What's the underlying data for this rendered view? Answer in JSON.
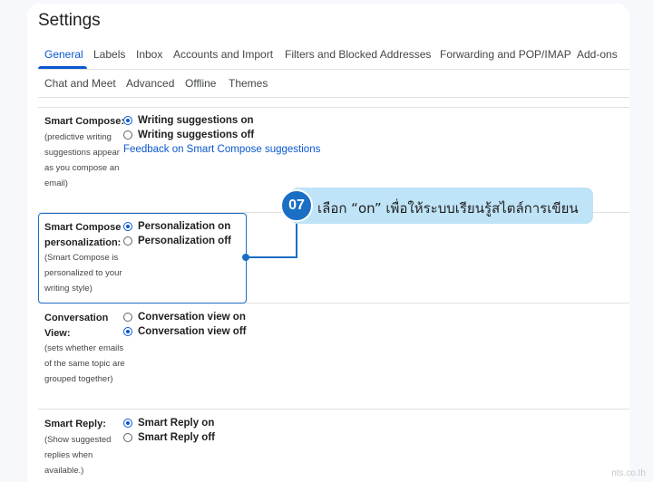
{
  "page": {
    "title": "Settings"
  },
  "tabs": [
    {
      "label": "General",
      "active": true
    },
    {
      "label": "Labels"
    },
    {
      "label": "Inbox"
    },
    {
      "label": "Accounts and Import"
    },
    {
      "label": "Filters and Blocked Addresses"
    },
    {
      "label": "Forwarding and POP/IMAP"
    },
    {
      "label": "Add-ons"
    },
    {
      "label": "Chat and Meet"
    },
    {
      "label": "Advanced"
    },
    {
      "label": "Offline"
    },
    {
      "label": "Themes"
    }
  ],
  "settings": {
    "smart_compose": {
      "title": "Smart Compose:",
      "desc": "(predictive writing suggestions appear as you compose an email)",
      "options": [
        "Writing suggestions on",
        "Writing suggestions off"
      ],
      "selected": 0,
      "link": "Feedback on Smart Compose suggestions"
    },
    "personalization": {
      "title": "Smart Compose personalization:",
      "desc": "(Smart Compose is personalized to your writing style)",
      "options": [
        "Personalization on",
        "Personalization off"
      ],
      "selected": 0
    },
    "conversation_view": {
      "title": "Conversation View:",
      "desc": "(sets whether emails of the same topic are grouped together)",
      "options": [
        "Conversation view on",
        "Conversation view off"
      ],
      "selected": 1
    },
    "smart_reply": {
      "title": "Smart Reply:",
      "desc": "(Show suggested replies when available.)",
      "options": [
        "Smart Reply on",
        "Smart Reply off"
      ],
      "selected": 0
    }
  },
  "callout": {
    "number": "07",
    "text": "เลือก “on” เพื่อให้ระบบเรียนรู้สไตล์การเขียน"
  },
  "watermark": "nts.co.th",
  "colors": {
    "accent": "#0b57d0",
    "callout_fill": "#bfe3f7",
    "callout_line": "#1a6fc4"
  }
}
